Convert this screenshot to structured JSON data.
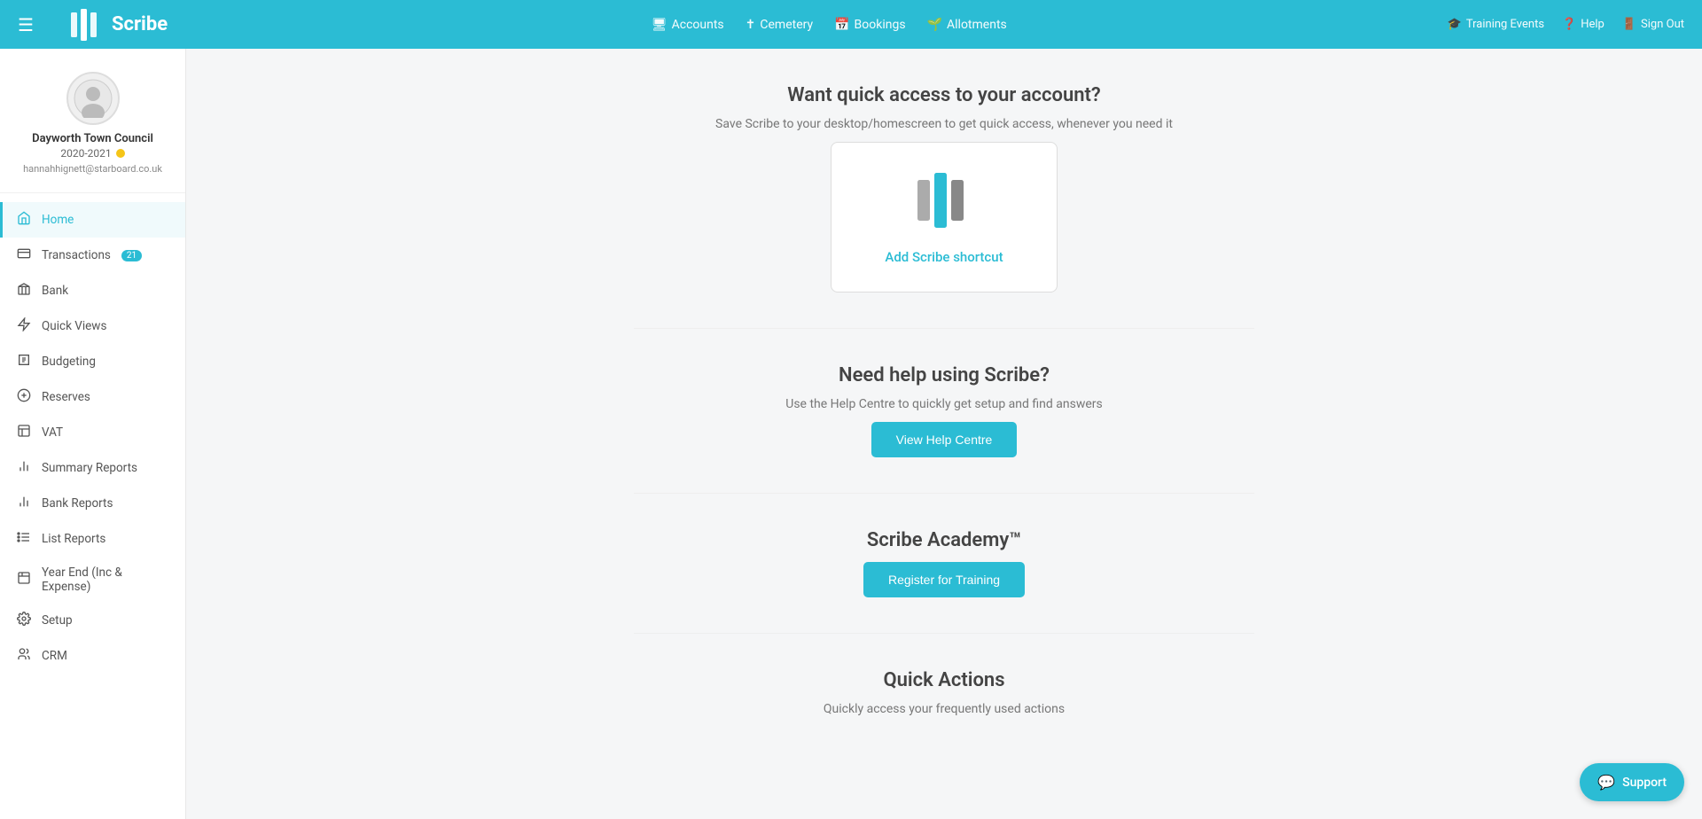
{
  "topnav": {
    "brand": "Scribe",
    "hamburger_label": "☰",
    "links": [
      {
        "label": "Accounts",
        "icon": "accounts-icon"
      },
      {
        "label": "Cemetery",
        "icon": "cemetery-icon"
      },
      {
        "label": "Bookings",
        "icon": "bookings-icon"
      },
      {
        "label": "Allotments",
        "icon": "allotments-icon"
      }
    ],
    "right_links": [
      {
        "label": "Training Events",
        "icon": "training-icon"
      },
      {
        "label": "Help",
        "icon": "help-icon"
      },
      {
        "label": "Sign Out",
        "icon": "signout-icon"
      }
    ]
  },
  "sidebar": {
    "profile": {
      "org_name": "Dayworth Town Council",
      "year": "2020-2021",
      "email": "hannahhignett@starboard.co.uk"
    },
    "nav_items": [
      {
        "label": "Home",
        "icon": "home-icon",
        "active": true
      },
      {
        "label": "Transactions",
        "icon": "transactions-icon",
        "badge": "21"
      },
      {
        "label": "Bank",
        "icon": "bank-icon"
      },
      {
        "label": "Quick Views",
        "icon": "quickviews-icon"
      },
      {
        "label": "Budgeting",
        "icon": "budgeting-icon"
      },
      {
        "label": "Reserves",
        "icon": "reserves-icon"
      },
      {
        "label": "VAT",
        "icon": "vat-icon"
      },
      {
        "label": "Summary Reports",
        "icon": "summaryreports-icon"
      },
      {
        "label": "Bank Reports",
        "icon": "bankreports-icon"
      },
      {
        "label": "List Reports",
        "icon": "listreports-icon"
      },
      {
        "label": "Year End (Inc & Expense)",
        "icon": "yearend-icon"
      },
      {
        "label": "Setup",
        "icon": "setup-icon"
      },
      {
        "label": "CRM",
        "icon": "crm-icon"
      }
    ]
  },
  "main": {
    "quick_access": {
      "title": "Want quick access to your account?",
      "subtitle": "Save Scribe to your desktop/homescreen to get quick access, whenever you need it",
      "shortcut_label": "Add Scribe shortcut"
    },
    "help_section": {
      "title": "Need help using Scribe?",
      "subtitle": "Use the Help Centre to quickly get setup and find answers",
      "button_label": "View Help Centre"
    },
    "academy_section": {
      "title": "Scribe Academy™",
      "button_label": "Register for Training"
    },
    "quick_actions": {
      "title": "Quick Actions",
      "subtitle": "Quickly access your frequently used actions"
    }
  },
  "colors": {
    "brand": "#2bbcd4",
    "active_border": "#2bbcd4",
    "badge_bg": "#2bbcd4",
    "year_dot": "#f5c518"
  }
}
